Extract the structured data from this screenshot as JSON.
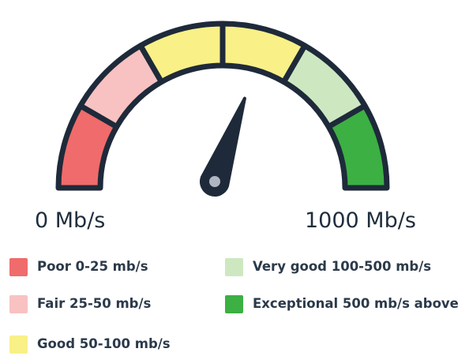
{
  "gauge": {
    "segments": [
      {
        "name": "poor",
        "color": "#f06b6b"
      },
      {
        "name": "fair",
        "color": "#f8c2c2"
      },
      {
        "name": "good-1",
        "color": "#f9f087"
      },
      {
        "name": "good-2",
        "color": "#f9f087"
      },
      {
        "name": "very-good",
        "color": "#cde8c1"
      },
      {
        "name": "exceptional",
        "color": "#3cb043"
      }
    ],
    "outline_color": "#1e2a3a",
    "needle_color": "#1e2a3a",
    "hub_dot_color": "#aeb6c2",
    "needle_value_fraction": 0.61,
    "min_label": "0 Mb/s",
    "max_label": "1000 Mb/s"
  },
  "legend": {
    "poor": {
      "label": "Poor 0-25 mb/s",
      "color": "#f06b6b"
    },
    "fair": {
      "label": "Fair 25-50 mb/s",
      "color": "#f8c2c2"
    },
    "good": {
      "label": "Good 50-100 mb/s",
      "color": "#f9f087"
    },
    "very_good": {
      "label": "Very good 100-500 mb/s",
      "color": "#cde8c1"
    },
    "exceptional": {
      "label": "Exceptional 500 mb/s above",
      "color": "#3cb043"
    }
  }
}
